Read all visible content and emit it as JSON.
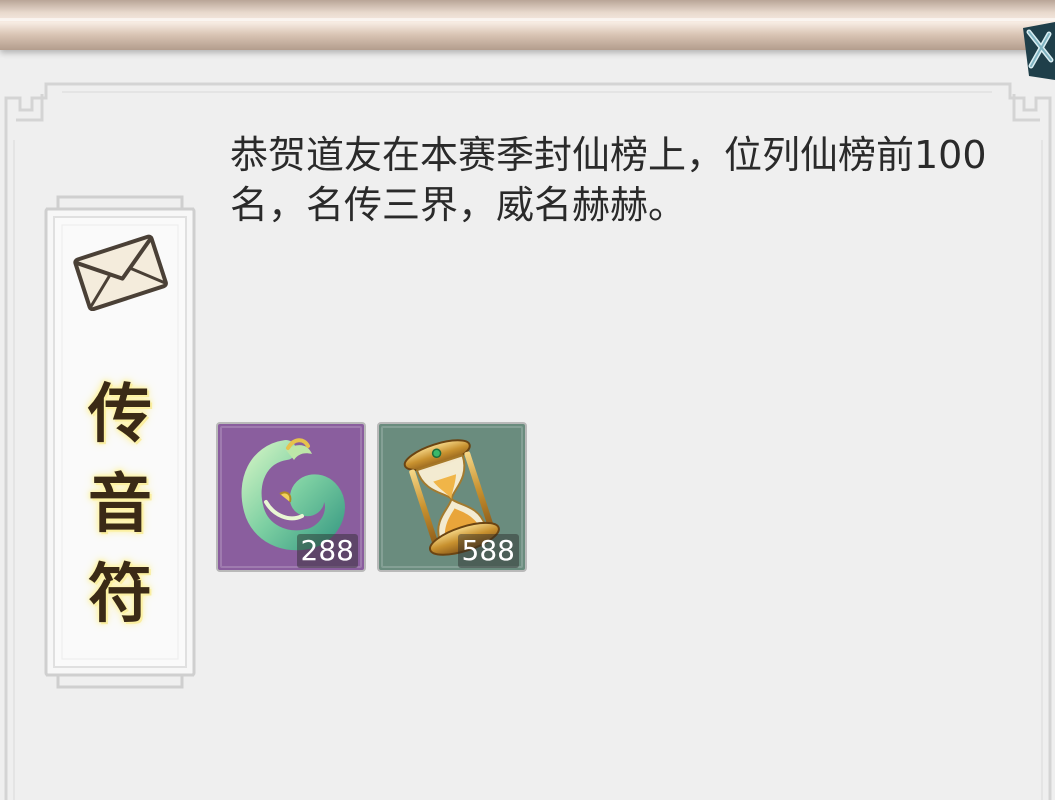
{
  "banner": {
    "chars": [
      "传",
      "音",
      "符"
    ]
  },
  "message": {
    "text": "恭贺道友在本赛季封仙榜上，位列仙榜前100名，名传三界，威名赫赫。"
  },
  "rewards": [
    {
      "icon": "jade-dragon-pendant-icon",
      "count": "288",
      "bg_color": "#8a5e9e"
    },
    {
      "icon": "golden-hourglass-icon",
      "count": "588",
      "bg_color": "#6a8c7e"
    }
  ],
  "colors": {
    "panel_bg": "#efefef",
    "banner_text": "#3b2a16"
  }
}
